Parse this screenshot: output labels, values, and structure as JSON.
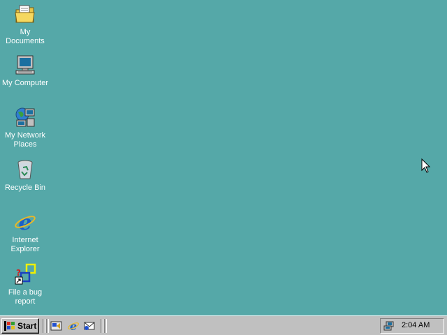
{
  "desktop": {
    "background_color": "#55a8a8",
    "icons": [
      {
        "label": "My Documents",
        "icon": "folder-documents-icon"
      },
      {
        "label": "My Computer",
        "icon": "computer-icon"
      },
      {
        "label": "My Network\nPlaces",
        "icon": "network-places-icon"
      },
      {
        "label": "Recycle Bin",
        "icon": "recycle-bin-icon"
      },
      {
        "label": "Internet\nExplorer",
        "icon": "internet-explorer-icon"
      },
      {
        "label": "File a bug\nreport",
        "icon": "bug-report-icon"
      }
    ]
  },
  "taskbar": {
    "start_label": "Start",
    "quick_launch": [
      "show-desktop-icon",
      "internet-explorer-icon",
      "outlook-express-icon"
    ],
    "clock": "2:04 AM",
    "tray_icon": "network-tray-icon"
  }
}
